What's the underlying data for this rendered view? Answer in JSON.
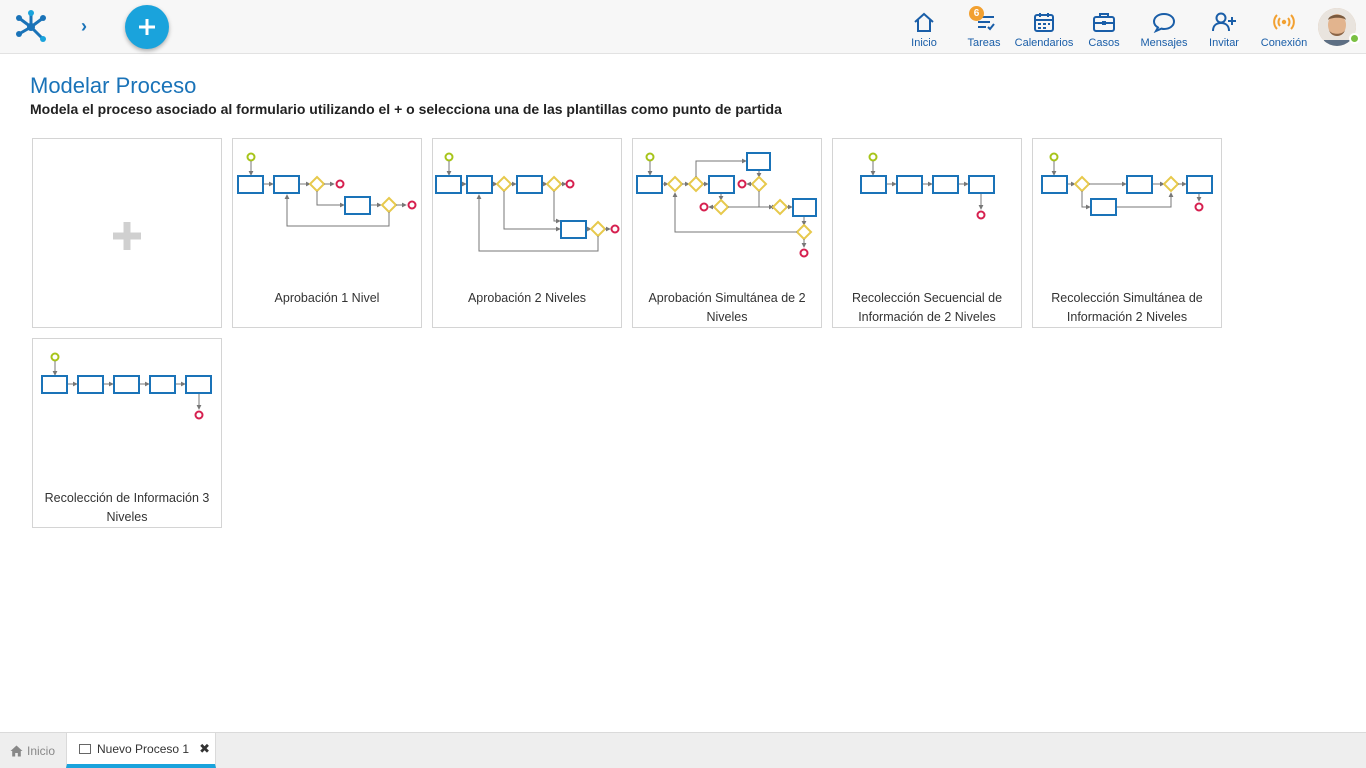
{
  "header": {
    "nav": [
      {
        "label": "Inicio",
        "icon": "home-icon"
      },
      {
        "label": "Tareas",
        "icon": "tasks-icon",
        "badge": "6"
      },
      {
        "label": "Calendarios",
        "icon": "calendar-icon"
      },
      {
        "label": "Casos",
        "icon": "briefcase-icon"
      },
      {
        "label": "Mensajes",
        "icon": "message-icon"
      },
      {
        "label": "Invitar",
        "icon": "invite-user-icon"
      },
      {
        "label": "Conexión",
        "icon": "connection-icon"
      }
    ],
    "colors": {
      "accent": "#1aa3dc",
      "nav_text": "#1a5ea8",
      "badge": "#f2a030",
      "connection": "#f2a030",
      "online": "#7ac043"
    }
  },
  "page": {
    "title": "Modelar Proceso",
    "subtitle": "Modela el proceso asociado al formulario utilizando el + o selecciona una de las plantillas como punto de partida"
  },
  "templates": [
    {
      "label": "Aprobación 1 Nivel"
    },
    {
      "label": "Aprobación 2 Niveles"
    },
    {
      "label": "Aprobación Simultánea de 2 Niveles"
    },
    {
      "label": "Recolección Secuencial de Información de 2 Niveles"
    },
    {
      "label": "Recolección Simultánea de Información 2 Niveles"
    },
    {
      "label": "Recolección de Información 3 Niveles"
    }
  ],
  "diagram_colors": {
    "task": "#1a73b8",
    "start": "#a7c41a",
    "end": "#d6204f",
    "gateway": "#e7c94c",
    "flow": "#777777"
  },
  "tabs": {
    "home_label": "Inicio",
    "active_label": "Nuevo Proceso 1"
  }
}
